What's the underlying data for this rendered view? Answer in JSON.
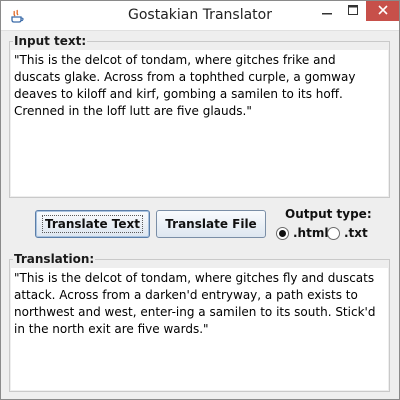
{
  "window": {
    "title": "Gostakian Translator",
    "icons": {
      "app": "java-app-icon",
      "minimize": "minimize-icon",
      "maximize": "maximize-icon",
      "close": "close-icon"
    },
    "close_color": "#c7504a"
  },
  "input": {
    "label": "Input text:",
    "text": "\"This is the delcot of tondam, where gitches frike and duscats glake. Across from a tophthed curple, a gomway deaves to kiloff and kirf, gombing a samilen to its hoff. Crenned in the loff lutt are five glauds.\""
  },
  "buttons": {
    "translate_text": "Translate Text",
    "translate_file": "Translate File"
  },
  "output_type": {
    "label": "Output type:",
    "options": [
      {
        "label": ".html",
        "selected": true
      },
      {
        "label": ".txt",
        "selected": false
      }
    ]
  },
  "translation": {
    "label": "Translation:",
    "text": "\"This is the delcot of tondam, where gitches fly and duscats attack. Across from a darken'd entryway, a path exists to northwest and west, enter-ing a samilen to its south. Stick'd in the north exit are five wards.\""
  }
}
